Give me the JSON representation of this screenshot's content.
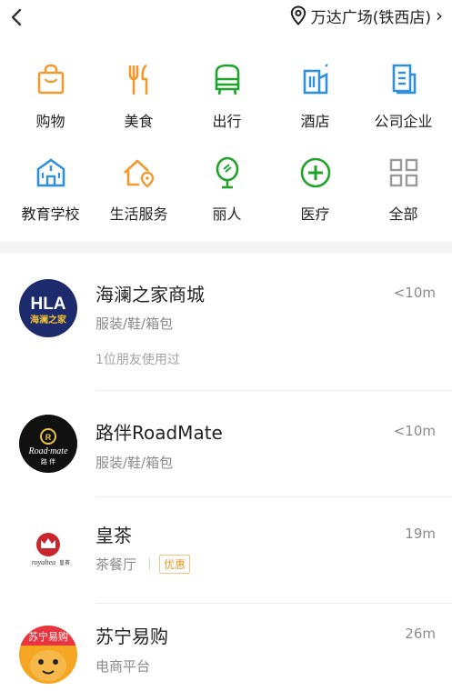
{
  "header": {
    "back_icon": "chevron-left-icon",
    "location_icon": "map-pin-icon",
    "location_label": "万达广场(铁西店)",
    "location_arrow": "›"
  },
  "categories": [
    {
      "label": "购物",
      "icon": "shopping-bag-icon",
      "color": "#f29a2e"
    },
    {
      "label": "美食",
      "icon": "fork-knife-icon",
      "color": "#f29a2e"
    },
    {
      "label": "出行",
      "icon": "bus-icon",
      "color": "#1fa32a"
    },
    {
      "label": "酒店",
      "icon": "hotel-building-icon",
      "color": "#2f8fe0"
    },
    {
      "label": "公司企业",
      "icon": "office-document-icon",
      "color": "#2f8fe0"
    },
    {
      "label": "教育学校",
      "icon": "school-icon",
      "color": "#2f8fe0"
    },
    {
      "label": "生活服务",
      "icon": "home-location-icon",
      "color": "#f29a2e"
    },
    {
      "label": "丽人",
      "icon": "mirror-icon",
      "color": "#1fa32a"
    },
    {
      "label": "医疗",
      "icon": "medical-plus-icon",
      "color": "#1fa32a"
    },
    {
      "label": "全部",
      "icon": "grid-icon",
      "color": "#9a9a9a"
    }
  ],
  "places": [
    {
      "name": "海澜之家商城",
      "category": "服装/鞋/箱包",
      "distance": "<10m",
      "friends": "1位朋友使用过",
      "logo_text": "HLA",
      "logo_sub": "海澜之家"
    },
    {
      "name": "路伴RoadMate",
      "category": "服装/鞋/箱包",
      "distance": "<10m",
      "logo_text": "Road·mate",
      "logo_sub": "路 伴"
    },
    {
      "name": "皇茶",
      "category": "茶餐厅",
      "distance": "19m",
      "tag": "优惠",
      "logo_text": "royaltea",
      "logo_sub": "皇茶"
    },
    {
      "name": "苏宁易购",
      "category": "电商平台",
      "distance": "26m",
      "logo_text": "苏宁易购"
    }
  ]
}
